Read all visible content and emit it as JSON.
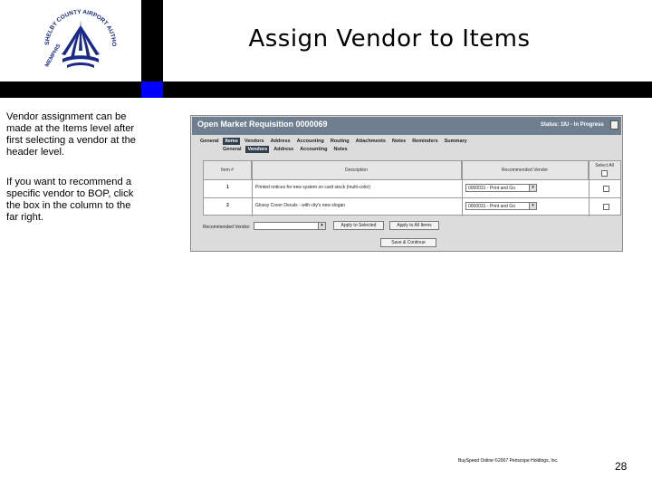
{
  "slide": {
    "title": "Assign Vendor to Items",
    "note1": "Vendor assignment can be made at the Items level after first selecting a vendor at the header level.",
    "note2": "If you want to recommend a specific vendor to BOP, click the box in the column to the far right.",
    "footer_credit": "BuySpeed Online ©2007 Periscope Holdings, Inc.",
    "page_number": "28"
  },
  "logo": {
    "text": "SHELBY COUNTY AIRPORT AUTHORITY MEMPHIS"
  },
  "screenshot": {
    "header_title": "Open Market Requisition 0000069",
    "status": "Status: 1IU - In Progress",
    "tabs_row1": [
      {
        "label": "General",
        "active": false
      },
      {
        "label": "Items",
        "active": true
      },
      {
        "label": "Vendors",
        "active": false
      },
      {
        "label": "Address",
        "active": false
      },
      {
        "label": "Accounting",
        "active": false
      },
      {
        "label": "Routing",
        "active": false
      },
      {
        "label": "Attachments",
        "active": false
      },
      {
        "label": "Notes",
        "active": false
      },
      {
        "label": "Reminders",
        "active": false
      },
      {
        "label": "Summary",
        "active": false
      }
    ],
    "tabs_row2": [
      {
        "label": "General",
        "active": false
      },
      {
        "label": "Vendors",
        "active": true
      },
      {
        "label": "Address",
        "active": false
      },
      {
        "label": "Accounting",
        "active": false
      },
      {
        "label": "Notes",
        "active": false
      }
    ],
    "columns": {
      "item": "Item #",
      "description": "Description",
      "recommended_vendor": "Recommended Vendor",
      "select_all": "Select All"
    },
    "rows": [
      {
        "item": "1",
        "description": "Printed notices for new system on card stock (multi-color)",
        "vendor": "0000031 - Print and Go"
      },
      {
        "item": "2",
        "description": "Glossy Cover Decals - with city's new slogan",
        "vendor": "0000031 - Print and Go"
      }
    ],
    "recommended_vendor_label": "Recommended Vendor:",
    "apply_selected_label": "Apply to Selected",
    "apply_all_label": "Apply to All Items",
    "save_continue_label": "Save & Continue"
  }
}
